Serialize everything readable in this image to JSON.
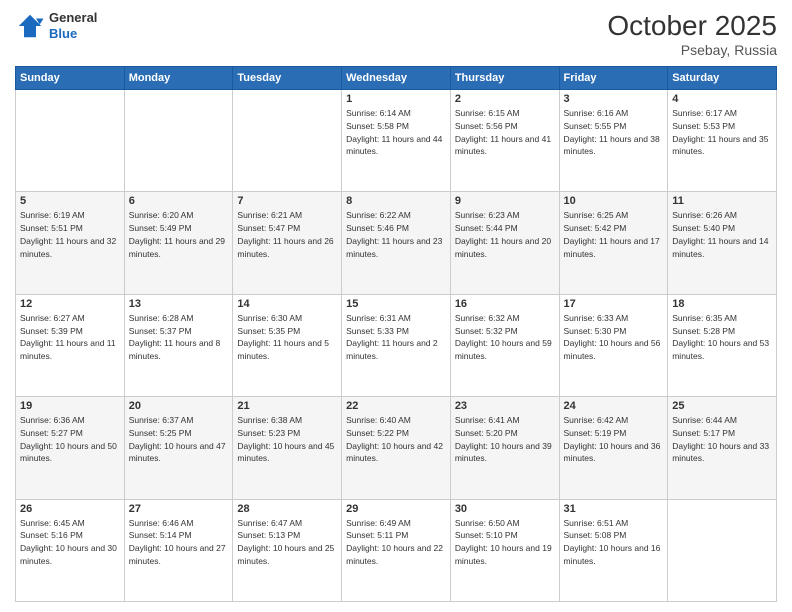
{
  "header": {
    "logo_line1": "General",
    "logo_line2": "Blue",
    "month": "October 2025",
    "location": "Psebay, Russia"
  },
  "days_of_week": [
    "Sunday",
    "Monday",
    "Tuesday",
    "Wednesday",
    "Thursday",
    "Friday",
    "Saturday"
  ],
  "weeks": [
    [
      {
        "day": "",
        "sunrise": "",
        "sunset": "",
        "daylight": ""
      },
      {
        "day": "",
        "sunrise": "",
        "sunset": "",
        "daylight": ""
      },
      {
        "day": "",
        "sunrise": "",
        "sunset": "",
        "daylight": ""
      },
      {
        "day": "1",
        "sunrise": "Sunrise: 6:14 AM",
        "sunset": "Sunset: 5:58 PM",
        "daylight": "Daylight: 11 hours and 44 minutes."
      },
      {
        "day": "2",
        "sunrise": "Sunrise: 6:15 AM",
        "sunset": "Sunset: 5:56 PM",
        "daylight": "Daylight: 11 hours and 41 minutes."
      },
      {
        "day": "3",
        "sunrise": "Sunrise: 6:16 AM",
        "sunset": "Sunset: 5:55 PM",
        "daylight": "Daylight: 11 hours and 38 minutes."
      },
      {
        "day": "4",
        "sunrise": "Sunrise: 6:17 AM",
        "sunset": "Sunset: 5:53 PM",
        "daylight": "Daylight: 11 hours and 35 minutes."
      }
    ],
    [
      {
        "day": "5",
        "sunrise": "Sunrise: 6:19 AM",
        "sunset": "Sunset: 5:51 PM",
        "daylight": "Daylight: 11 hours and 32 minutes."
      },
      {
        "day": "6",
        "sunrise": "Sunrise: 6:20 AM",
        "sunset": "Sunset: 5:49 PM",
        "daylight": "Daylight: 11 hours and 29 minutes."
      },
      {
        "day": "7",
        "sunrise": "Sunrise: 6:21 AM",
        "sunset": "Sunset: 5:47 PM",
        "daylight": "Daylight: 11 hours and 26 minutes."
      },
      {
        "day": "8",
        "sunrise": "Sunrise: 6:22 AM",
        "sunset": "Sunset: 5:46 PM",
        "daylight": "Daylight: 11 hours and 23 minutes."
      },
      {
        "day": "9",
        "sunrise": "Sunrise: 6:23 AM",
        "sunset": "Sunset: 5:44 PM",
        "daylight": "Daylight: 11 hours and 20 minutes."
      },
      {
        "day": "10",
        "sunrise": "Sunrise: 6:25 AM",
        "sunset": "Sunset: 5:42 PM",
        "daylight": "Daylight: 11 hours and 17 minutes."
      },
      {
        "day": "11",
        "sunrise": "Sunrise: 6:26 AM",
        "sunset": "Sunset: 5:40 PM",
        "daylight": "Daylight: 11 hours and 14 minutes."
      }
    ],
    [
      {
        "day": "12",
        "sunrise": "Sunrise: 6:27 AM",
        "sunset": "Sunset: 5:39 PM",
        "daylight": "Daylight: 11 hours and 11 minutes."
      },
      {
        "day": "13",
        "sunrise": "Sunrise: 6:28 AM",
        "sunset": "Sunset: 5:37 PM",
        "daylight": "Daylight: 11 hours and 8 minutes."
      },
      {
        "day": "14",
        "sunrise": "Sunrise: 6:30 AM",
        "sunset": "Sunset: 5:35 PM",
        "daylight": "Daylight: 11 hours and 5 minutes."
      },
      {
        "day": "15",
        "sunrise": "Sunrise: 6:31 AM",
        "sunset": "Sunset: 5:33 PM",
        "daylight": "Daylight: 11 hours and 2 minutes."
      },
      {
        "day": "16",
        "sunrise": "Sunrise: 6:32 AM",
        "sunset": "Sunset: 5:32 PM",
        "daylight": "Daylight: 10 hours and 59 minutes."
      },
      {
        "day": "17",
        "sunrise": "Sunrise: 6:33 AM",
        "sunset": "Sunset: 5:30 PM",
        "daylight": "Daylight: 10 hours and 56 minutes."
      },
      {
        "day": "18",
        "sunrise": "Sunrise: 6:35 AM",
        "sunset": "Sunset: 5:28 PM",
        "daylight": "Daylight: 10 hours and 53 minutes."
      }
    ],
    [
      {
        "day": "19",
        "sunrise": "Sunrise: 6:36 AM",
        "sunset": "Sunset: 5:27 PM",
        "daylight": "Daylight: 10 hours and 50 minutes."
      },
      {
        "day": "20",
        "sunrise": "Sunrise: 6:37 AM",
        "sunset": "Sunset: 5:25 PM",
        "daylight": "Daylight: 10 hours and 47 minutes."
      },
      {
        "day": "21",
        "sunrise": "Sunrise: 6:38 AM",
        "sunset": "Sunset: 5:23 PM",
        "daylight": "Daylight: 10 hours and 45 minutes."
      },
      {
        "day": "22",
        "sunrise": "Sunrise: 6:40 AM",
        "sunset": "Sunset: 5:22 PM",
        "daylight": "Daylight: 10 hours and 42 minutes."
      },
      {
        "day": "23",
        "sunrise": "Sunrise: 6:41 AM",
        "sunset": "Sunset: 5:20 PM",
        "daylight": "Daylight: 10 hours and 39 minutes."
      },
      {
        "day": "24",
        "sunrise": "Sunrise: 6:42 AM",
        "sunset": "Sunset: 5:19 PM",
        "daylight": "Daylight: 10 hours and 36 minutes."
      },
      {
        "day": "25",
        "sunrise": "Sunrise: 6:44 AM",
        "sunset": "Sunset: 5:17 PM",
        "daylight": "Daylight: 10 hours and 33 minutes."
      }
    ],
    [
      {
        "day": "26",
        "sunrise": "Sunrise: 6:45 AM",
        "sunset": "Sunset: 5:16 PM",
        "daylight": "Daylight: 10 hours and 30 minutes."
      },
      {
        "day": "27",
        "sunrise": "Sunrise: 6:46 AM",
        "sunset": "Sunset: 5:14 PM",
        "daylight": "Daylight: 10 hours and 27 minutes."
      },
      {
        "day": "28",
        "sunrise": "Sunrise: 6:47 AM",
        "sunset": "Sunset: 5:13 PM",
        "daylight": "Daylight: 10 hours and 25 minutes."
      },
      {
        "day": "29",
        "sunrise": "Sunrise: 6:49 AM",
        "sunset": "Sunset: 5:11 PM",
        "daylight": "Daylight: 10 hours and 22 minutes."
      },
      {
        "day": "30",
        "sunrise": "Sunrise: 6:50 AM",
        "sunset": "Sunset: 5:10 PM",
        "daylight": "Daylight: 10 hours and 19 minutes."
      },
      {
        "day": "31",
        "sunrise": "Sunrise: 6:51 AM",
        "sunset": "Sunset: 5:08 PM",
        "daylight": "Daylight: 10 hours and 16 minutes."
      },
      {
        "day": "",
        "sunrise": "",
        "sunset": "",
        "daylight": ""
      }
    ]
  ]
}
